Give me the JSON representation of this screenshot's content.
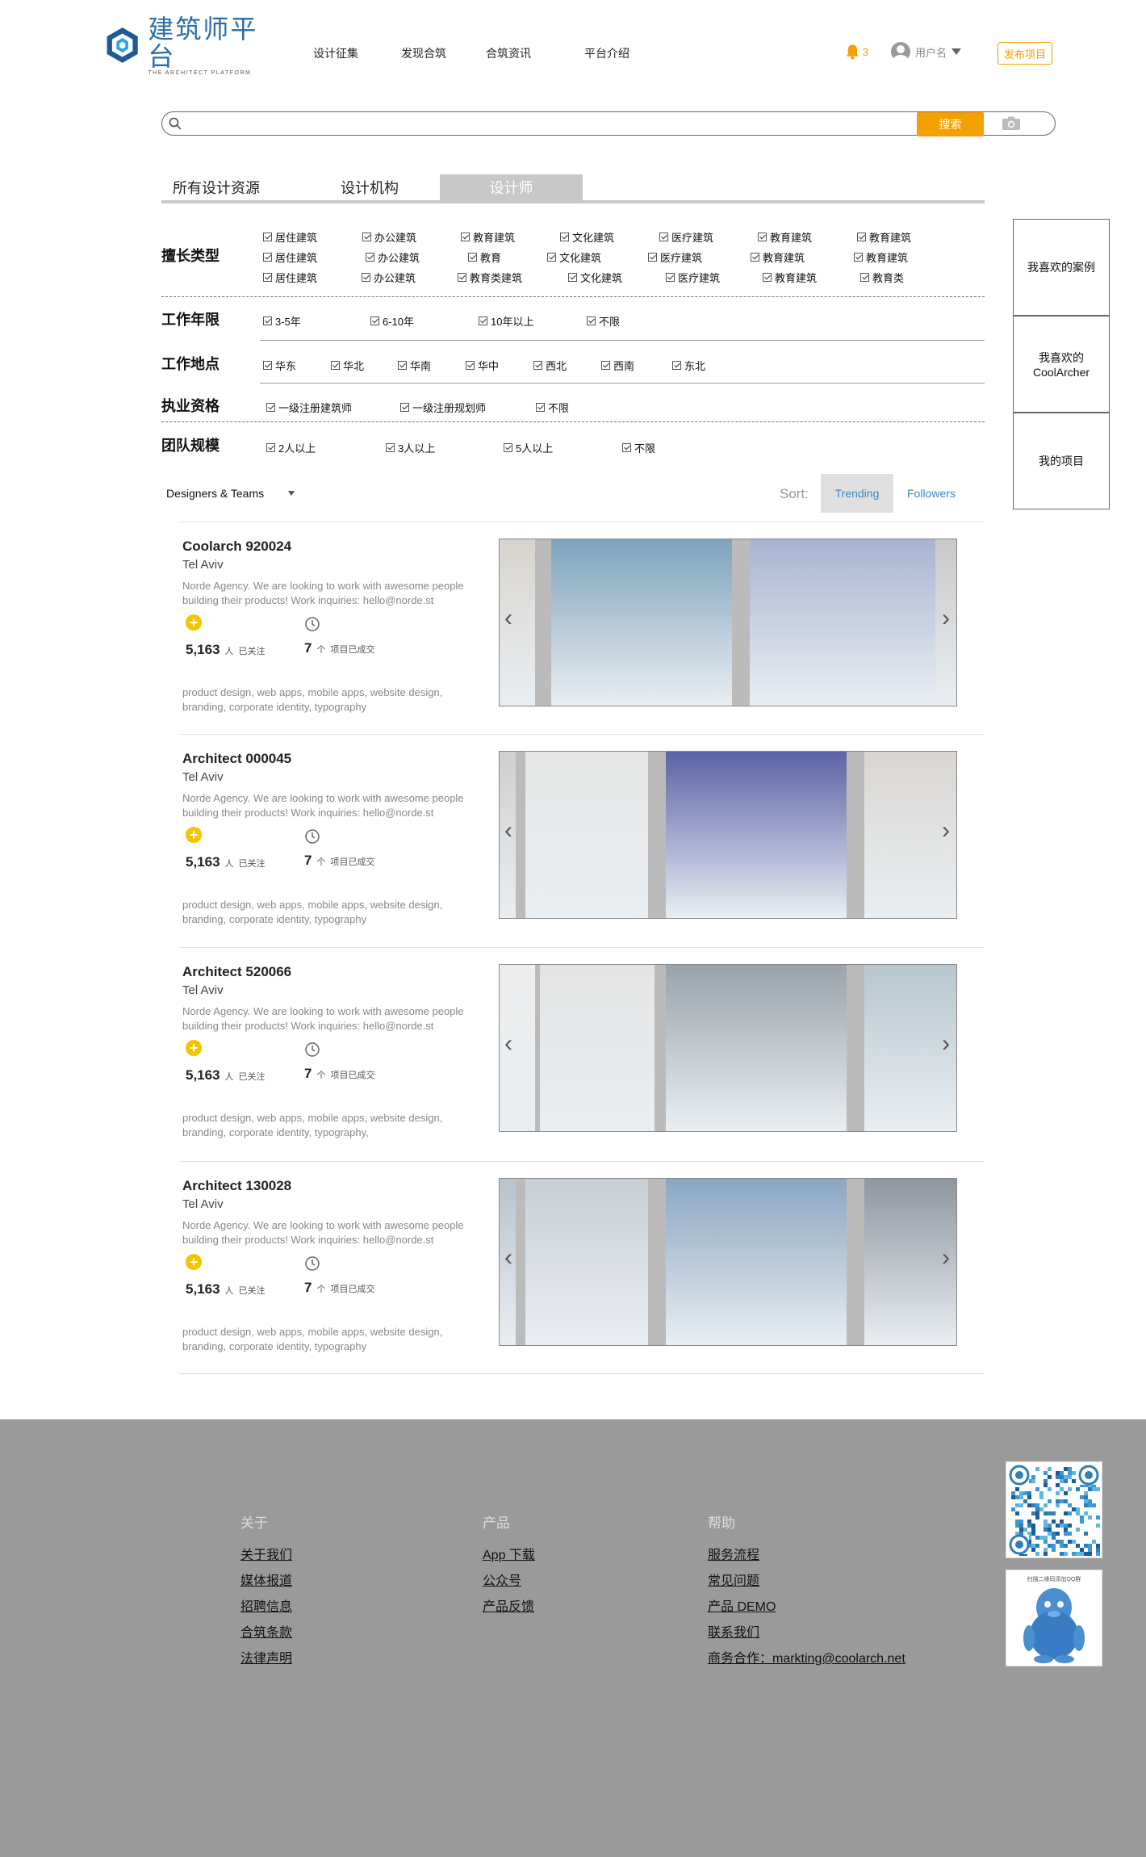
{
  "header": {
    "logo_cn": "建筑师平台",
    "logo_en": "THE ARCHITECT PLATFORM",
    "nav": [
      "设计征集",
      "发现合筑",
      "合筑资讯",
      "平台介绍"
    ],
    "notification_count": "3",
    "username": "用户名",
    "publish_label": "发布项目"
  },
  "search": {
    "placeholder": "",
    "button_label": "搜索"
  },
  "tabs": [
    "所有设计资源",
    "设计机构",
    "设计师"
  ],
  "active_tab": "设计师",
  "filters": {
    "specialty": {
      "label": "擅长类型",
      "rows": [
        [
          "居住建筑",
          "办公建筑",
          "教育建筑",
          "文化建筑",
          "医疗建筑",
          "教育建筑",
          "教育建筑"
        ],
        [
          "居住建筑",
          "办公建筑",
          "教育",
          "文化建筑",
          "医疗建筑",
          "教育建筑",
          "教育建筑"
        ],
        [
          "居住建筑",
          "办公建筑",
          "教育类建筑",
          "文化建筑",
          "医疗建筑",
          "教育建筑",
          "教育类"
        ]
      ]
    },
    "years": {
      "label": "工作年限",
      "options": [
        "3-5年",
        "6-10年",
        "10年以上",
        "不限"
      ]
    },
    "location": {
      "label": "工作地点",
      "options": [
        "华东",
        "华北",
        "华南",
        "华中",
        "西北",
        "西南",
        "东北"
      ]
    },
    "qualification": {
      "label": "执业资格",
      "options": [
        "一级注册建筑师",
        "一级注册规划师",
        "不限"
      ]
    },
    "team": {
      "label": "团队规模",
      "options": [
        "2人以上",
        "3人以上",
        "5人以上",
        "不限"
      ]
    }
  },
  "side_panel": [
    "我喜欢的案例",
    "我喜欢的 CoolArcher",
    "我的项目"
  ],
  "list_toolbar": {
    "scope_select": "Designers & Teams",
    "sort_label": "Sort:",
    "sort_options": [
      "Trending",
      "Followers"
    ],
    "active_sort": "Trending"
  },
  "designers": [
    {
      "name": "Coolarch 920024",
      "location": "Tel Aviv",
      "description": "Norde Agency. We are looking to work with awesome people building their products! Work inquiries: hello@norde.st",
      "followers": "5,163",
      "followers_unit": "人",
      "followers_label": "已关注",
      "projects": "7",
      "projects_unit": "个",
      "projects_label": "项目已成交",
      "tags": "product design, web apps, mobile apps, website design, branding, corporate identity, typography"
    },
    {
      "name": "Architect 000045",
      "location": "Tel Aviv",
      "description": "Norde Agency. We are looking to work with awesome people building their products! Work inquiries: hello@norde.st",
      "followers": "5,163",
      "followers_unit": "人",
      "followers_label": "已关注",
      "projects": "7",
      "projects_unit": "个",
      "projects_label": "项目已成交",
      "tags": "product design, web apps, mobile apps, website design, branding, corporate identity, typography"
    },
    {
      "name": "Architect 520066",
      "location": "Tel Aviv",
      "description": "Norde Agency. We are looking to work with awesome people building their products! Work inquiries: hello@norde.st",
      "followers": "5,163",
      "followers_unit": "人",
      "followers_label": "已关注",
      "projects": "7",
      "projects_unit": "个",
      "projects_label": "项目已成交",
      "tags": "product design, web apps, mobile apps, website design, branding, corporate identity, typography,"
    },
    {
      "name": "Architect 130028",
      "location": "Tel Aviv",
      "description": "Norde Agency. We are looking to work with awesome people building their products! Work inquiries: hello@norde.st",
      "followers": "5,163",
      "followers_unit": "人",
      "followers_label": "已关注",
      "projects": "7",
      "projects_unit": "个",
      "projects_label": "项目已成交",
      "tags": "product design, web apps, mobile apps, website design, branding, corporate identity, typography"
    }
  ],
  "footer": {
    "columns": [
      {
        "heading": "关于",
        "links": [
          "关于我们",
          "媒体报道",
          "招聘信息",
          "合筑条款",
          "法律声明"
        ]
      },
      {
        "heading": "产品",
        "links": [
          "App 下载",
          "公众号",
          "产品反馈"
        ]
      },
      {
        "heading": "帮助",
        "links": [
          "服务流程",
          "常见问题",
          "产品 DEMO",
          "联系我们",
          "商务合作：markting@coolarch.net"
        ]
      }
    ],
    "qq_caption": "扫描二维码添加QQ群"
  },
  "colors": {
    "accent": "#f4a000",
    "brand": "#2a6ea8",
    "link": "#3b86c6",
    "footer_bg": "#9a9a9a",
    "tab_active": "#c8c8c8"
  }
}
